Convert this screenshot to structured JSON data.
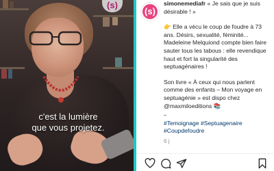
{
  "video": {
    "logo_text": "(s)",
    "subtitle_line1": "c'est la lumière",
    "subtitle_line2": "que vous projetez."
  },
  "post": {
    "avatar_text": "(s)",
    "username": "simonemediafr",
    "intro": "« Je sais que je suis désirable ! »",
    "paragraph1": "👉 Elle a vécu le coup de foudre à 73 ans. Désirs, sexualité, féminité... Madeleine Melquiond compte bien faire sauter tous les tabous : elle revendique haut et fort la singularité des septuagénaires !",
    "paragraph2": "Son livre « À ceux qui nous parlent comme des enfants – Mon voyage en septuagénie » est dispo chez @maxmiloeditions 📚",
    "separator": "⎯",
    "tags": "#Temoignage #Septuagenaire #Coupdefoudre",
    "time": "6 j"
  },
  "actions": {
    "heart_icon": "heart-icon",
    "comment_icon": "comment-icon",
    "share_icon": "share-icon",
    "save_icon": "bookmark-icon"
  },
  "colors": {
    "brand_pink": "#e8437f",
    "teal": "#22c7c2",
    "link_blue": "#00376b"
  }
}
